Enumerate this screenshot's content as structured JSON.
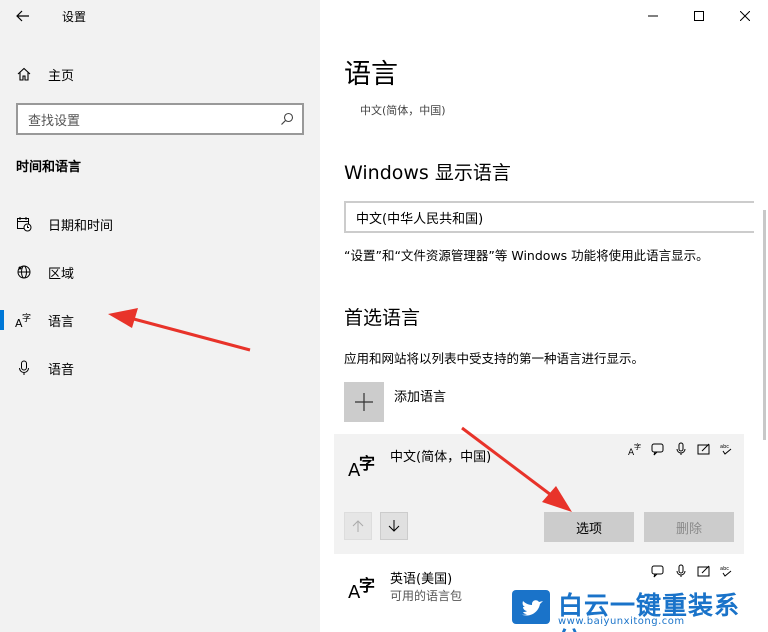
{
  "window": {
    "title": "设置"
  },
  "sidebar": {
    "home_label": "主页",
    "search_placeholder": "查找设置",
    "section_title": "时间和语言",
    "items": [
      {
        "label": "日期和时间",
        "icon": "calendar-clock-icon"
      },
      {
        "label": "区域",
        "icon": "globe-icon"
      },
      {
        "label": "语言",
        "icon": "language-icon",
        "selected": true
      },
      {
        "label": "语音",
        "icon": "microphone-icon"
      }
    ]
  },
  "main": {
    "title": "语言",
    "subtitle": "中文(简体，中国)",
    "display_language": {
      "heading": "Windows 显示语言",
      "selected": "中文(中华人民共和国)",
      "note": "“设置”和“文件资源管理器”等 Windows 功能将使用此语言显示。"
    },
    "preferred": {
      "heading": "首选语言",
      "note": "应用和网站将以列表中受支持的第一种语言进行显示。",
      "add_label": "添加语言",
      "languages": [
        {
          "name": "中文(简体，中国)",
          "pack": ""
        },
        {
          "name": "英语(美国)",
          "pack": "可用的语言包"
        }
      ],
      "options_label": "选项",
      "remove_label": "删除"
    }
  },
  "watermark": {
    "text": "白云一键重装系统",
    "url": "www.baiyunxitong.com"
  },
  "colors": {
    "accent": "#0078d7",
    "annotation": "#e8332a",
    "watermark": "#1a73c9"
  }
}
